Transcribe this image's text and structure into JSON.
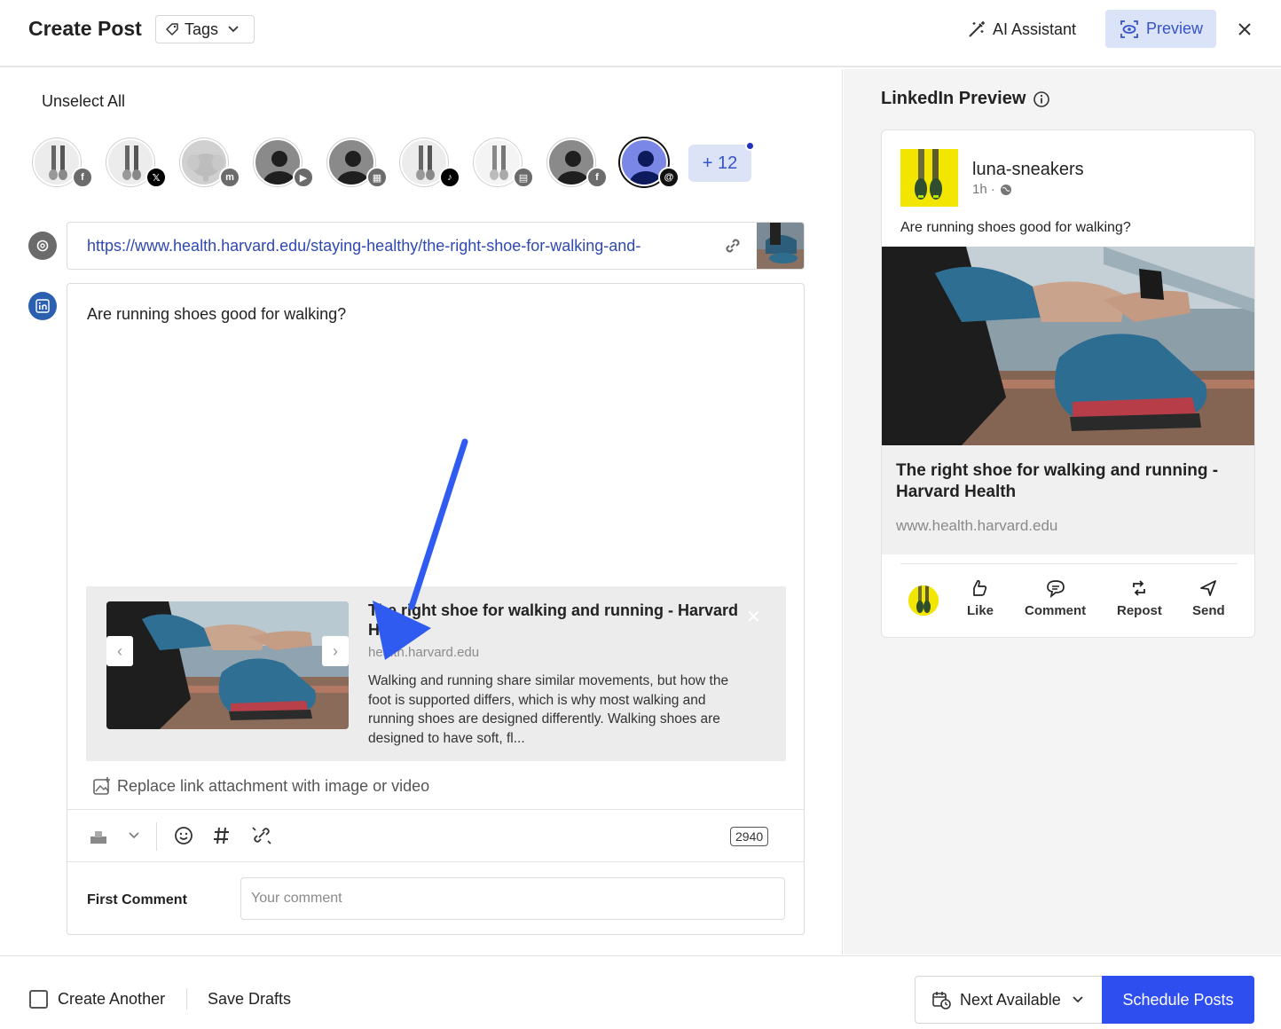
{
  "header": {
    "title": "Create Post",
    "tags_label": "Tags",
    "ai_label": "AI Assistant",
    "preview_label": "Preview"
  },
  "composer": {
    "unselect_all": "Unselect All",
    "more_accounts": "+ 12",
    "accounts": [
      {
        "network": "facebook",
        "badge_icon": "facebook-icon"
      },
      {
        "network": "x",
        "badge_icon": "x-icon"
      },
      {
        "network": "mastodon",
        "badge_icon": "mastodon-icon"
      },
      {
        "network": "youtube",
        "badge_icon": "youtube-icon"
      },
      {
        "network": "google-business",
        "badge_icon": "google-business-icon"
      },
      {
        "network": "tiktok",
        "badge_icon": "tiktok-icon"
      },
      {
        "network": "other",
        "badge_icon": "contact-card-icon"
      },
      {
        "network": "facebook",
        "badge_icon": "facebook-icon"
      },
      {
        "network": "threads",
        "badge_icon": "threads-icon",
        "selected": true
      }
    ],
    "url": "https://www.health.harvard.edu/staying-healthy/the-right-shoe-for-walking-and-",
    "post_text": "Are running shoes good for walking?",
    "link_card": {
      "title": "The right shoe for walking and running - Harvard Health",
      "domain": "health.harvard.edu",
      "description": "Walking and running share similar movements, but how the foot is supported differs, which is why most walking and running shoes are designed differently. Walking shoes are designed to have soft, fl..."
    },
    "replace_label": "Replace link attachment with image or video",
    "char_count": "2940",
    "first_comment_label": "First Comment",
    "first_comment_placeholder": "Your comment"
  },
  "preview": {
    "heading": "LinkedIn Preview",
    "account_name": "luna-sneakers",
    "time": "1h ·",
    "post_text": "Are running shoes good for walking?",
    "link_title": "The right shoe for walking and running - Harvard Health",
    "link_domain": "www.health.harvard.edu",
    "actions": [
      "Like",
      "Comment",
      "Repost",
      "Send"
    ]
  },
  "footer": {
    "create_another": "Create Another",
    "save_drafts": "Save Drafts",
    "next_available": "Next Available",
    "schedule": "Schedule Posts"
  },
  "colors": {
    "accent": "#2e4ef0",
    "preview_bg": "#dbe3f8",
    "link": "#2f49b3",
    "arrow": "#2f5bf0"
  }
}
